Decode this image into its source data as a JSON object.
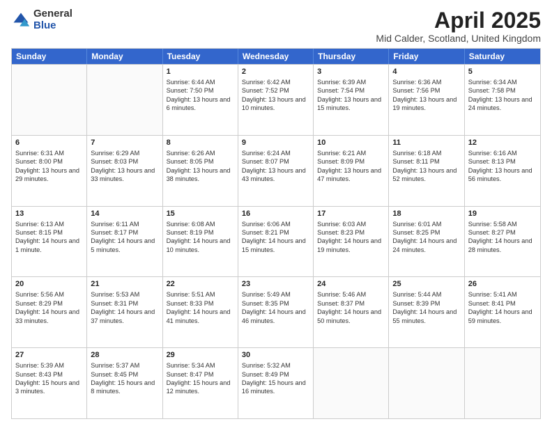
{
  "logo": {
    "general": "General",
    "blue": "Blue"
  },
  "title": {
    "month_year": "April 2025",
    "location": "Mid Calder, Scotland, United Kingdom"
  },
  "days_of_week": [
    "Sunday",
    "Monday",
    "Tuesday",
    "Wednesday",
    "Thursday",
    "Friday",
    "Saturday"
  ],
  "weeks": [
    [
      {
        "day": "",
        "sunrise": "",
        "sunset": "",
        "daylight": ""
      },
      {
        "day": "",
        "sunrise": "",
        "sunset": "",
        "daylight": ""
      },
      {
        "day": "1",
        "sunrise": "Sunrise: 6:44 AM",
        "sunset": "Sunset: 7:50 PM",
        "daylight": "Daylight: 13 hours and 6 minutes."
      },
      {
        "day": "2",
        "sunrise": "Sunrise: 6:42 AM",
        "sunset": "Sunset: 7:52 PM",
        "daylight": "Daylight: 13 hours and 10 minutes."
      },
      {
        "day": "3",
        "sunrise": "Sunrise: 6:39 AM",
        "sunset": "Sunset: 7:54 PM",
        "daylight": "Daylight: 13 hours and 15 minutes."
      },
      {
        "day": "4",
        "sunrise": "Sunrise: 6:36 AM",
        "sunset": "Sunset: 7:56 PM",
        "daylight": "Daylight: 13 hours and 19 minutes."
      },
      {
        "day": "5",
        "sunrise": "Sunrise: 6:34 AM",
        "sunset": "Sunset: 7:58 PM",
        "daylight": "Daylight: 13 hours and 24 minutes."
      }
    ],
    [
      {
        "day": "6",
        "sunrise": "Sunrise: 6:31 AM",
        "sunset": "Sunset: 8:00 PM",
        "daylight": "Daylight: 13 hours and 29 minutes."
      },
      {
        "day": "7",
        "sunrise": "Sunrise: 6:29 AM",
        "sunset": "Sunset: 8:03 PM",
        "daylight": "Daylight: 13 hours and 33 minutes."
      },
      {
        "day": "8",
        "sunrise": "Sunrise: 6:26 AM",
        "sunset": "Sunset: 8:05 PM",
        "daylight": "Daylight: 13 hours and 38 minutes."
      },
      {
        "day": "9",
        "sunrise": "Sunrise: 6:24 AM",
        "sunset": "Sunset: 8:07 PM",
        "daylight": "Daylight: 13 hours and 43 minutes."
      },
      {
        "day": "10",
        "sunrise": "Sunrise: 6:21 AM",
        "sunset": "Sunset: 8:09 PM",
        "daylight": "Daylight: 13 hours and 47 minutes."
      },
      {
        "day": "11",
        "sunrise": "Sunrise: 6:18 AM",
        "sunset": "Sunset: 8:11 PM",
        "daylight": "Daylight: 13 hours and 52 minutes."
      },
      {
        "day": "12",
        "sunrise": "Sunrise: 6:16 AM",
        "sunset": "Sunset: 8:13 PM",
        "daylight": "Daylight: 13 hours and 56 minutes."
      }
    ],
    [
      {
        "day": "13",
        "sunrise": "Sunrise: 6:13 AM",
        "sunset": "Sunset: 8:15 PM",
        "daylight": "Daylight: 14 hours and 1 minute."
      },
      {
        "day": "14",
        "sunrise": "Sunrise: 6:11 AM",
        "sunset": "Sunset: 8:17 PM",
        "daylight": "Daylight: 14 hours and 5 minutes."
      },
      {
        "day": "15",
        "sunrise": "Sunrise: 6:08 AM",
        "sunset": "Sunset: 8:19 PM",
        "daylight": "Daylight: 14 hours and 10 minutes."
      },
      {
        "day": "16",
        "sunrise": "Sunrise: 6:06 AM",
        "sunset": "Sunset: 8:21 PM",
        "daylight": "Daylight: 14 hours and 15 minutes."
      },
      {
        "day": "17",
        "sunrise": "Sunrise: 6:03 AM",
        "sunset": "Sunset: 8:23 PM",
        "daylight": "Daylight: 14 hours and 19 minutes."
      },
      {
        "day": "18",
        "sunrise": "Sunrise: 6:01 AM",
        "sunset": "Sunset: 8:25 PM",
        "daylight": "Daylight: 14 hours and 24 minutes."
      },
      {
        "day": "19",
        "sunrise": "Sunrise: 5:58 AM",
        "sunset": "Sunset: 8:27 PM",
        "daylight": "Daylight: 14 hours and 28 minutes."
      }
    ],
    [
      {
        "day": "20",
        "sunrise": "Sunrise: 5:56 AM",
        "sunset": "Sunset: 8:29 PM",
        "daylight": "Daylight: 14 hours and 33 minutes."
      },
      {
        "day": "21",
        "sunrise": "Sunrise: 5:53 AM",
        "sunset": "Sunset: 8:31 PM",
        "daylight": "Daylight: 14 hours and 37 minutes."
      },
      {
        "day": "22",
        "sunrise": "Sunrise: 5:51 AM",
        "sunset": "Sunset: 8:33 PM",
        "daylight": "Daylight: 14 hours and 41 minutes."
      },
      {
        "day": "23",
        "sunrise": "Sunrise: 5:49 AM",
        "sunset": "Sunset: 8:35 PM",
        "daylight": "Daylight: 14 hours and 46 minutes."
      },
      {
        "day": "24",
        "sunrise": "Sunrise: 5:46 AM",
        "sunset": "Sunset: 8:37 PM",
        "daylight": "Daylight: 14 hours and 50 minutes."
      },
      {
        "day": "25",
        "sunrise": "Sunrise: 5:44 AM",
        "sunset": "Sunset: 8:39 PM",
        "daylight": "Daylight: 14 hours and 55 minutes."
      },
      {
        "day": "26",
        "sunrise": "Sunrise: 5:41 AM",
        "sunset": "Sunset: 8:41 PM",
        "daylight": "Daylight: 14 hours and 59 minutes."
      }
    ],
    [
      {
        "day": "27",
        "sunrise": "Sunrise: 5:39 AM",
        "sunset": "Sunset: 8:43 PM",
        "daylight": "Daylight: 15 hours and 3 minutes."
      },
      {
        "day": "28",
        "sunrise": "Sunrise: 5:37 AM",
        "sunset": "Sunset: 8:45 PM",
        "daylight": "Daylight: 15 hours and 8 minutes."
      },
      {
        "day": "29",
        "sunrise": "Sunrise: 5:34 AM",
        "sunset": "Sunset: 8:47 PM",
        "daylight": "Daylight: 15 hours and 12 minutes."
      },
      {
        "day": "30",
        "sunrise": "Sunrise: 5:32 AM",
        "sunset": "Sunset: 8:49 PM",
        "daylight": "Daylight: 15 hours and 16 minutes."
      },
      {
        "day": "",
        "sunrise": "",
        "sunset": "",
        "daylight": ""
      },
      {
        "day": "",
        "sunrise": "",
        "sunset": "",
        "daylight": ""
      },
      {
        "day": "",
        "sunrise": "",
        "sunset": "",
        "daylight": ""
      }
    ]
  ]
}
